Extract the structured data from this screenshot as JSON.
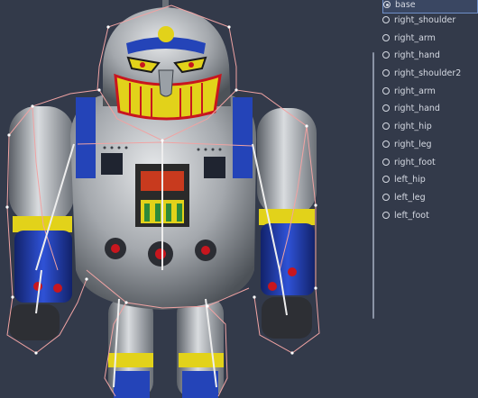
{
  "viewport": {
    "subject_icon": "robot-sprite"
  },
  "bone_tree": {
    "selected_index": 0,
    "items": [
      {
        "label": "base"
      },
      {
        "label": "right_shoulder"
      },
      {
        "label": "right_arm"
      },
      {
        "label": "right_hand"
      },
      {
        "label": "right_shoulder2"
      },
      {
        "label": "right_arm"
      },
      {
        "label": "right_hand"
      },
      {
        "label": "right_hip"
      },
      {
        "label": "right_leg"
      },
      {
        "label": "right_foot"
      },
      {
        "label": "left_hip"
      },
      {
        "label": "left_leg"
      },
      {
        "label": "left_foot"
      }
    ]
  },
  "colors": {
    "background": "#333a4a",
    "robot_silver": "#a4a8ad",
    "robot_blue": "#1f3aa8",
    "robot_yellow": "#e8d21a",
    "robot_red": "#c8161e",
    "bone_line": "#f0a3a3"
  }
}
